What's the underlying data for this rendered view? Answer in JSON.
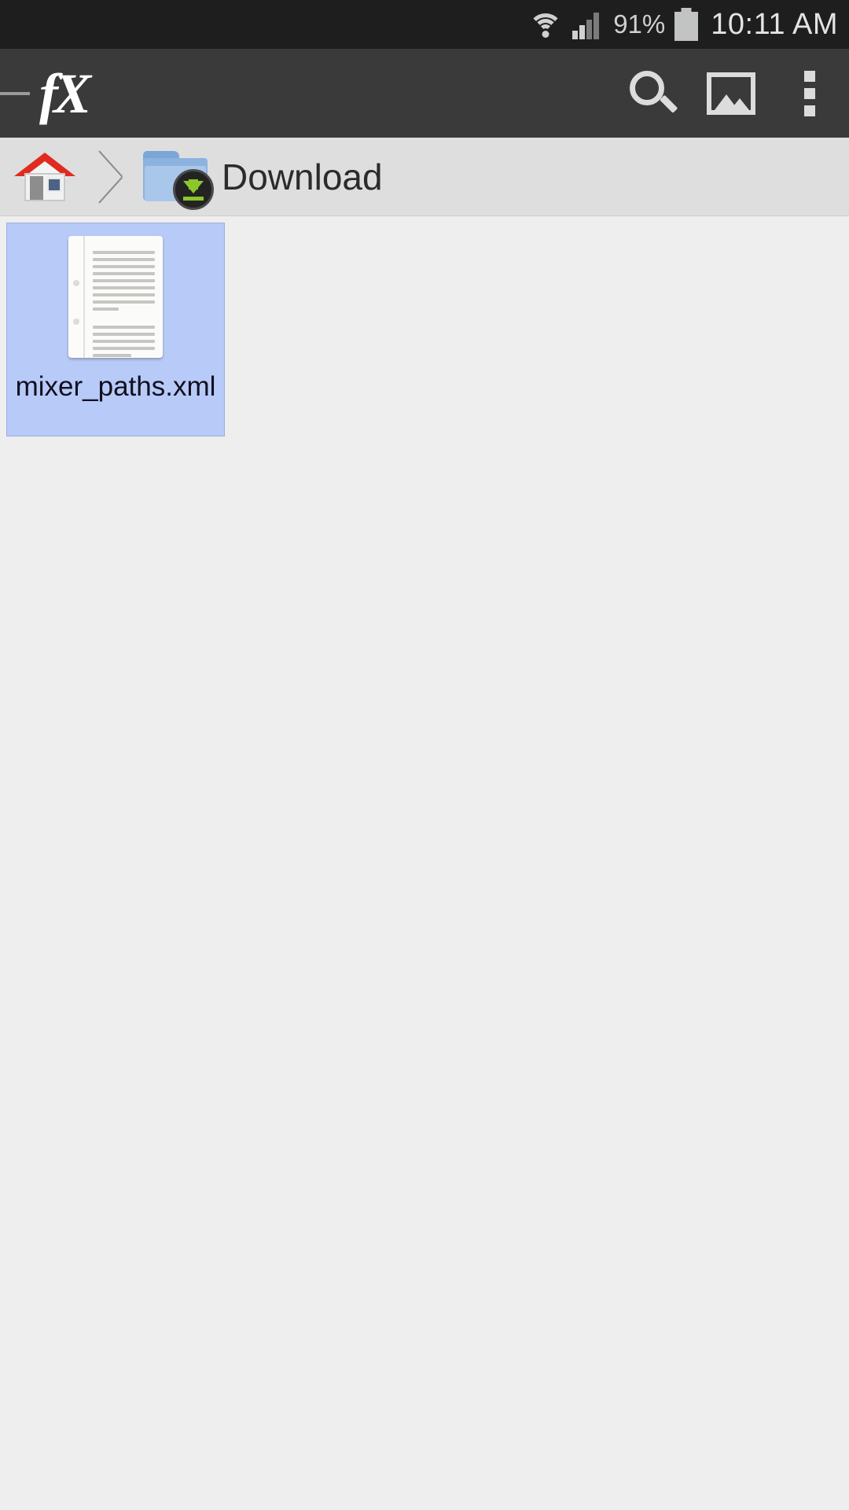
{
  "status_bar": {
    "wifi_icon": "wifi-icon",
    "signal_icon": "cellular-signal-icon",
    "battery_percent": "91%",
    "battery_icon": "battery-icon",
    "time": "10:11 AM"
  },
  "app_bar": {
    "drawer_handle": "drawer-handle",
    "logo_text": "fX",
    "actions": [
      {
        "name": "search-icon",
        "label": "Search"
      },
      {
        "name": "image-icon",
        "label": "Images"
      },
      {
        "name": "overflow-menu-icon",
        "label": "More options"
      }
    ]
  },
  "breadcrumb": {
    "items": [
      {
        "name": "home",
        "label": "",
        "icon": "home-icon"
      },
      {
        "name": "download",
        "label": "Download",
        "icon": "folder-download-icon"
      }
    ],
    "separator": "chevron-right-icon"
  },
  "files": [
    {
      "name": "mixer_paths.xml",
      "label": "mixer_paths.xml",
      "icon": "text-document-icon",
      "selected": true
    }
  ],
  "colors": {
    "status_bar_bg": "#1e1e1e",
    "app_bar_bg": "#3a3a3a",
    "breadcrumb_bg": "#dedede",
    "content_bg": "#eeeeee",
    "tile_selected_bg": "#b8caf7",
    "tile_selected_border": "#9aafe0",
    "accent_red": "#e02b20",
    "accent_green": "#8bc72a",
    "folder_blue": "#a9c7ea"
  }
}
